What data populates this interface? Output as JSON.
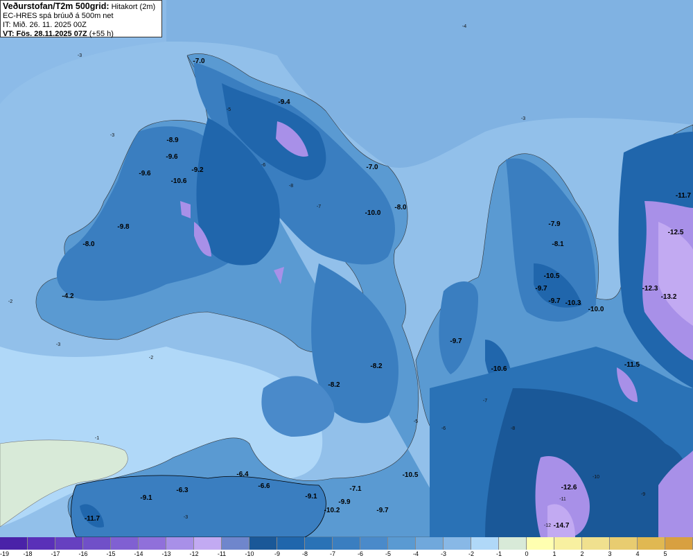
{
  "header": {
    "title_bold": "Veðurstofan/T2m 500grid:",
    "title_rest": "Hitakort (2m)",
    "model_line": "EC-HRES spá brúuð á 500m net",
    "init_time": "IT: Mið. 26. 11. 2025 00Z",
    "valid_bold": "VT: Fös. 28.11.2025 07Z",
    "valid_rest": "(+55 h)"
  },
  "colorbar": {
    "ticks": [
      "-19",
      "-18",
      "-17",
      "-16",
      "-15",
      "-14",
      "-13",
      "-12",
      "-11",
      "-10",
      "-9",
      "-8",
      "-7",
      "-6",
      "-5",
      "-4",
      "-3",
      "-2",
      "-1",
      "0",
      "1",
      "2",
      "3",
      "4",
      "5"
    ],
    "colors": [
      "#4a22a8",
      "#5a30b8",
      "#6640c0",
      "#7050c8",
      "#8060d2",
      "#9070da",
      "#a890e8",
      "#c2aaf2",
      "#6f86cc",
      "#1a5898",
      "#2066ac",
      "#2a72b6",
      "#3a7ec0",
      "#4a8aca",
      "#5a9ad2",
      "#70a8dc",
      "#88b8e6",
      "#b0d8f8",
      "#d8ead8",
      "#ffffb0",
      "#f8f0a0",
      "#f0e08e",
      "#e8cc70",
      "#e0b852",
      "#d8a040"
    ]
  },
  "map": {
    "value_labels": [
      "-7.0",
      "-9.4",
      "-8.9",
      "-9.6",
      "-9.2",
      "-9.6",
      "-10.6",
      "-7.0",
      "-10.0",
      "-8.0",
      "-9.8",
      "-8.0",
      "-4.2",
      "-7.9",
      "-8.1",
      "-10.5",
      "-9.7",
      "-9.7",
      "-10.3",
      "-10.0",
      "-11.7",
      "-12.5",
      "-12.3",
      "-13.2",
      "-9.7",
      "-10.6",
      "-11.5",
      "-8.2",
      "-8.2",
      "-12.6",
      "-14.7",
      "-10.5",
      "-6.4",
      "-6.6",
      "-7.1",
      "-9.1",
      "-6.3",
      "-9.1",
      "-9.9",
      "-10.2",
      "-9.7",
      "-11.7"
    ],
    "contour_labels": [
      "-4",
      "-3",
      "-3",
      "-3",
      "-2",
      "-3",
      "-2",
      "-1",
      "-3",
      "-5",
      "-6",
      "-7",
      "-8",
      "-5",
      "-6",
      "-7",
      "-8",
      "-10",
      "-11",
      "-12",
      "-9"
    ],
    "colors": {
      "sea_far": "#80b2e2",
      "sea": "#92c0ea",
      "sea_near": "#b0d8f8",
      "zero_zone": "#d8ead8",
      "land_low": "#5a9ad2",
      "land": "#3a7ec0",
      "land_high": "#2066ac",
      "cold": "#a890e8",
      "colder": "#c2aaf2",
      "coast": "#000000"
    }
  }
}
